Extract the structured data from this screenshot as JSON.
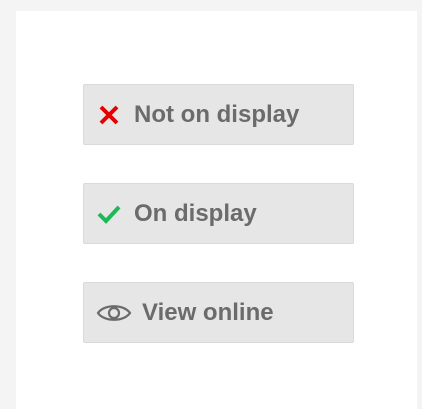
{
  "buttons": {
    "not_on_display": {
      "label": "Not on display",
      "icon": "cross-icon",
      "icon_color": "#e60000"
    },
    "on_display": {
      "label": "On display",
      "icon": "checkmark-icon",
      "icon_color": "#1db954"
    },
    "view_online": {
      "label": "View online",
      "icon": "eye-icon",
      "icon_color": "#6b6b6b"
    }
  },
  "colors": {
    "page_background": "#f4f4f4",
    "panel_background": "#ffffff",
    "button_background": "#e6e6e6",
    "label_text": "#6b6b6b"
  }
}
